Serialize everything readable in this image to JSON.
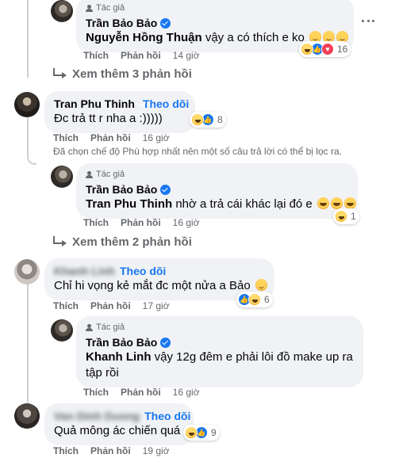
{
  "labels": {
    "like": "Thích",
    "reply": "Phản hồi",
    "follow": "Theo dõi",
    "author_tag": "Tác giả"
  },
  "comments": [
    {
      "author": "Trần Bảo Bảo",
      "mention": "Nguyễn Hồng Thuận",
      "text": "vậy a có thích e ko",
      "time": "14 giờ",
      "reaction_count": "16"
    },
    {
      "author": "Tran Phu Thinh",
      "text": "Đc trả tt r nha a :)))))",
      "time": "16 giờ",
      "reaction_count": "8"
    },
    {
      "author": "Trần Bảo Bảo",
      "mention": "Tran Phu Thinh",
      "text": "nhờ a trả cái khác lại đó e",
      "time": "16 giờ",
      "reaction_count": "1"
    },
    {
      "author": "Khanh Linh",
      "text": "Chỉ hi vọng kẻ mắt đc một nửa a Bảo",
      "time": "17 giờ",
      "reaction_count": "6"
    },
    {
      "author": "Trần Bảo Bảo",
      "mention": "Khanh Linh",
      "text_line1": "vậy 12g đêm e phải lôi đồ make up ra",
      "text_line2": "tập rồi",
      "time": "16 giờ"
    },
    {
      "author": "Van Dinh Duong",
      "text": "Quả mông ác chiến quá",
      "time": "19 giờ",
      "reaction_count": "9"
    }
  ],
  "see_more": [
    {
      "label": "Xem thêm 3 phản hồi"
    },
    {
      "label": "Xem thêm 2 phản hồi"
    }
  ],
  "filter_note": "Đã chọn chế độ Phù hợp nhất nên một số câu trả lời có thể bị lọc ra.",
  "icons": {
    "verified": "verified-badge-icon",
    "more": "more-options-icon",
    "reply_arrow": "reply-arrow-icon",
    "haha": "haha-reaction-icon",
    "like": "like-reaction-icon",
    "love": "love-reaction-icon"
  },
  "colors": {
    "accent": "#1877f2",
    "bubble": "#f0f2f5",
    "secondary_text": "#65676b"
  }
}
